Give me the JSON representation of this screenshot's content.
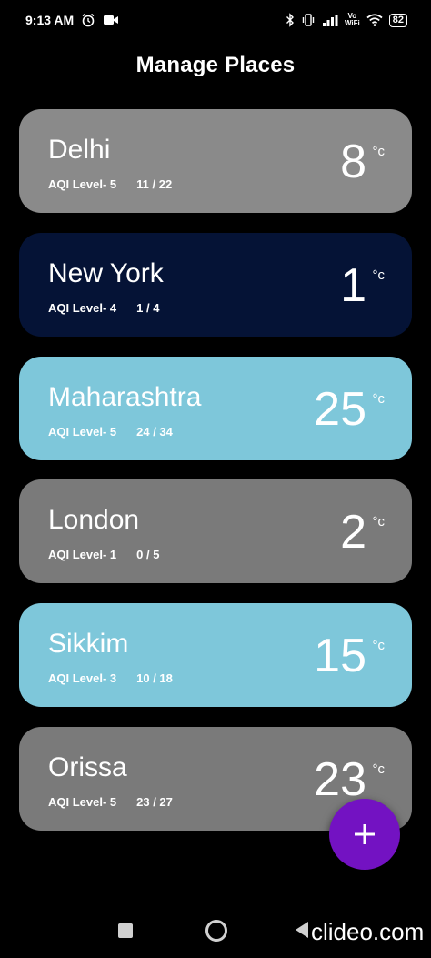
{
  "status_bar": {
    "time": "9:13 AM",
    "signal_label_top": "Vo",
    "signal_label_bottom": "WiFi",
    "battery": "82"
  },
  "header": {
    "title": "Manage Places"
  },
  "places": [
    {
      "city": "Delhi",
      "aqi_label": "AQI Level- 5",
      "range": "11 / 22",
      "temp": "8",
      "unit": "°c",
      "color": "#8a8a8a"
    },
    {
      "city": "New York",
      "aqi_label": "AQI Level- 4",
      "range": "1 / 4",
      "temp": "1",
      "unit": "°c",
      "color": "#051336"
    },
    {
      "city": "Maharashtra",
      "aqi_label": "AQI Level- 5",
      "range": "24 / 34",
      "temp": "25",
      "unit": "°c",
      "color": "#7ec7da"
    },
    {
      "city": "London",
      "aqi_label": "AQI Level- 1",
      "range": "0 / 5",
      "temp": "2",
      "unit": "°c",
      "color": "#7a7a7a"
    },
    {
      "city": "Sikkim",
      "aqi_label": "AQI Level- 3",
      "range": "10 / 18",
      "temp": "15",
      "unit": "°c",
      "color": "#7ec7da"
    },
    {
      "city": "Orissa",
      "aqi_label": "AQI Level- 5",
      "range": "23 / 27",
      "temp": "23",
      "unit": "°c",
      "color": "#7a7a7a"
    }
  ],
  "fab": {
    "icon": "plus-icon",
    "color": "#7312c2"
  },
  "watermark": "clideo.com"
}
